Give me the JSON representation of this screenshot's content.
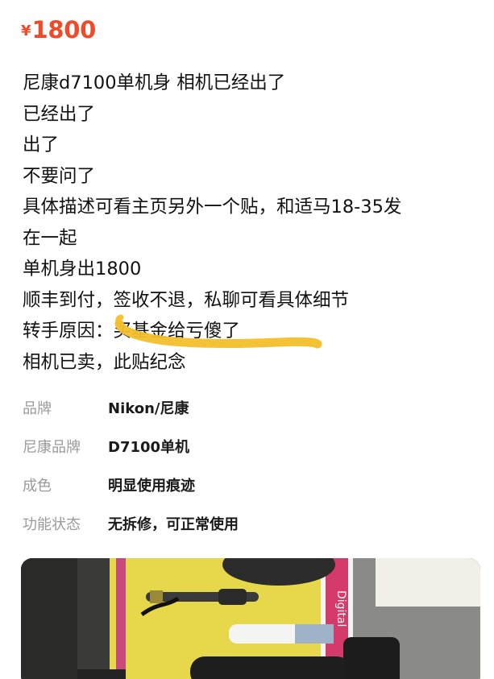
{
  "price": {
    "currency": "¥",
    "amount": "1800",
    "color": "#ef4b2b"
  },
  "description_lines": [
    "尼康d7100单机身 相机已经出了",
    "已经出了",
    "出了",
    "不要问了",
    "具体描述可看主页另外一个贴，和适马18-35发",
    "在一起",
    "单机身出1800",
    "顺丰到付，签收不退，私聊可看具体细节",
    "转手原因：买基金给亏傻了",
    "相机已卖，此贴纪念"
  ],
  "specs": [
    {
      "key": "品牌",
      "value": "Nikon/尼康"
    },
    {
      "key": "尼康品牌",
      "value": "D7100单机"
    },
    {
      "key": "成色",
      "value": "明显使用痕迹"
    },
    {
      "key": "功能状态",
      "value": "无拆修，可正常使用"
    }
  ],
  "highlight_color": "#f3bf2b",
  "photo": {
    "package_label": "Digital"
  }
}
